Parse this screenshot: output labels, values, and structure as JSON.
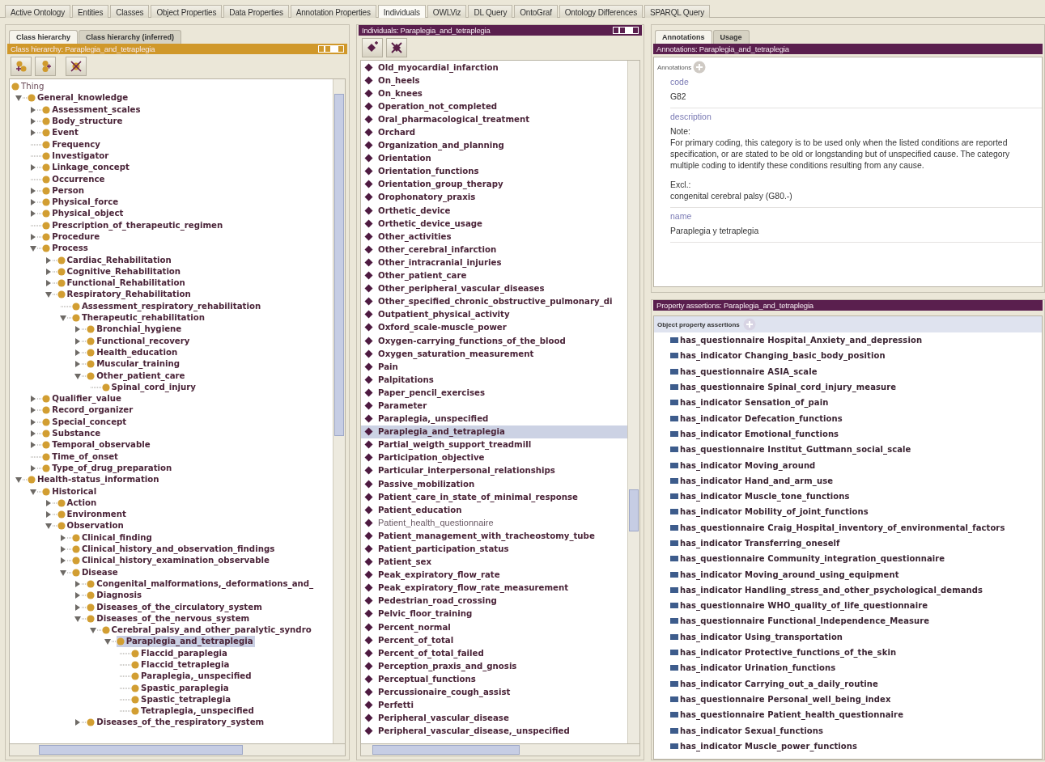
{
  "main_tabs": [
    {
      "label": "Active Ontology",
      "selected": false
    },
    {
      "label": "Entities",
      "selected": false
    },
    {
      "label": "Classes",
      "selected": false
    },
    {
      "label": "Object Properties",
      "selected": false
    },
    {
      "label": "Data Properties",
      "selected": false
    },
    {
      "label": "Annotation Properties",
      "selected": false
    },
    {
      "label": "Individuals",
      "selected": true
    },
    {
      "label": "OWLViz",
      "selected": false
    },
    {
      "label": "DL Query",
      "selected": false
    },
    {
      "label": "OntoGraf",
      "selected": false
    },
    {
      "label": "Ontology Differences",
      "selected": false
    },
    {
      "label": "SPARQL Query",
      "selected": false
    }
  ],
  "class_hierarchy": {
    "tabs": [
      {
        "label": "Class hierarchy",
        "selected": true
      },
      {
        "label": "Class hierarchy (inferred)",
        "selected": false
      }
    ],
    "header": "Class hierarchy: Paraplegia_and_tetraplegia",
    "tree": [
      {
        "label": "Thing",
        "kind": "root",
        "selected": false,
        "children": [
          {
            "label": "General_knowledge",
            "kind": "branch",
            "expanded": true,
            "selected": false,
            "children": [
              {
                "label": "Assessment_scales",
                "kind": "branch",
                "expanded": false,
                "selected": false
              },
              {
                "label": "Body_structure",
                "kind": "branch",
                "expanded": false,
                "selected": false
              },
              {
                "label": "Event",
                "kind": "branch",
                "expanded": false,
                "selected": false
              },
              {
                "label": "Frequency",
                "kind": "leaf",
                "selected": false
              },
              {
                "label": "Investigator",
                "kind": "leaf",
                "selected": false
              },
              {
                "label": "Linkage_concept",
                "kind": "branch",
                "expanded": false,
                "selected": false
              },
              {
                "label": "Occurrence",
                "kind": "leaf",
                "selected": false
              },
              {
                "label": "Person",
                "kind": "branch",
                "expanded": false,
                "selected": false
              },
              {
                "label": "Physical_force",
                "kind": "branch",
                "expanded": false,
                "selected": false
              },
              {
                "label": "Physical_object",
                "kind": "branch",
                "expanded": false,
                "selected": false
              },
              {
                "label": "Prescription_of_therapeutic_regimen",
                "kind": "leaf",
                "selected": false
              },
              {
                "label": "Procedure",
                "kind": "branch",
                "expanded": false,
                "selected": false
              },
              {
                "label": "Process",
                "kind": "branch",
                "expanded": true,
                "selected": false,
                "children": [
                  {
                    "label": "Cardiac_Rehabilitation",
                    "kind": "branch",
                    "expanded": false,
                    "selected": false
                  },
                  {
                    "label": "Cognitive_Rehabilitation",
                    "kind": "branch",
                    "expanded": false,
                    "selected": false
                  },
                  {
                    "label": "Functional_Rehabilitation",
                    "kind": "branch",
                    "expanded": false,
                    "selected": false
                  },
                  {
                    "label": "Respiratory_Rehabilitation",
                    "kind": "branch",
                    "expanded": true,
                    "selected": false,
                    "children": [
                      {
                        "label": "Assessment_respiratory_rehabilitation",
                        "kind": "leaf",
                        "selected": false
                      },
                      {
                        "label": "Therapeutic_rehabilitation",
                        "kind": "branch",
                        "expanded": true,
                        "selected": false,
                        "children": [
                          {
                            "label": "Bronchial_hygiene",
                            "kind": "branch",
                            "expanded": false,
                            "selected": false
                          },
                          {
                            "label": "Functional_recovery",
                            "kind": "branch",
                            "expanded": false,
                            "selected": false
                          },
                          {
                            "label": "Health_education",
                            "kind": "branch",
                            "expanded": false,
                            "selected": false
                          },
                          {
                            "label": "Muscular_training",
                            "kind": "branch",
                            "expanded": false,
                            "selected": false
                          },
                          {
                            "label": "Other_patient_care",
                            "kind": "branch",
                            "expanded": true,
                            "selected": false,
                            "children": [
                              {
                                "label": "Spinal_cord_injury",
                                "kind": "leaf",
                                "selected": false
                              }
                            ]
                          }
                        ]
                      }
                    ]
                  }
                ]
              },
              {
                "label": "Qualifier_value",
                "kind": "branch",
                "expanded": false,
                "selected": false
              },
              {
                "label": "Record_organizer",
                "kind": "branch",
                "expanded": false,
                "selected": false
              },
              {
                "label": "Special_concept",
                "kind": "branch",
                "expanded": false,
                "selected": false
              },
              {
                "label": "Substance",
                "kind": "branch",
                "expanded": false,
                "selected": false
              },
              {
                "label": "Temporal_observable",
                "kind": "branch",
                "expanded": false,
                "selected": false
              },
              {
                "label": "Time_of_onset",
                "kind": "leaf",
                "selected": false
              },
              {
                "label": "Type_of_drug_preparation",
                "kind": "branch",
                "expanded": false,
                "selected": false
              }
            ]
          },
          {
            "label": "Health-status_information",
            "kind": "branch",
            "expanded": true,
            "selected": false,
            "children": [
              {
                "label": "Historical",
                "kind": "branch",
                "expanded": true,
                "selected": false,
                "children": [
                  {
                    "label": "Action",
                    "kind": "branch",
                    "expanded": false,
                    "selected": false
                  },
                  {
                    "label": "Environment",
                    "kind": "branch",
                    "expanded": false,
                    "selected": false
                  },
                  {
                    "label": "Observation",
                    "kind": "branch",
                    "expanded": true,
                    "selected": false,
                    "children": [
                      {
                        "label": "Clinical_finding",
                        "kind": "branch",
                        "expanded": false,
                        "selected": false
                      },
                      {
                        "label": "Clinical_history_and_observation_findings",
                        "kind": "branch",
                        "expanded": false,
                        "selected": false
                      },
                      {
                        "label": "Clinical_history_examination_observable",
                        "kind": "branch",
                        "expanded": false,
                        "selected": false
                      },
                      {
                        "label": "Disease",
                        "kind": "branch",
                        "expanded": true,
                        "selected": false,
                        "children": [
                          {
                            "label": "Congenital_malformations,_deformations_and_",
                            "kind": "branch",
                            "expanded": false,
                            "selected": false
                          },
                          {
                            "label": "Diagnosis",
                            "kind": "branch",
                            "expanded": false,
                            "selected": false
                          },
                          {
                            "label": "Diseases_of_the_circulatory_system",
                            "kind": "branch",
                            "expanded": false,
                            "selected": false
                          },
                          {
                            "label": "Diseases_of_the_nervous_system",
                            "kind": "branch",
                            "expanded": true,
                            "selected": false,
                            "children": [
                              {
                                "label": "Cerebral_palsy_and_other_paralytic_syndro",
                                "kind": "branch",
                                "expanded": true,
                                "selected": false,
                                "children": [
                                  {
                                    "label": "Paraplegia_and_tetraplegia",
                                    "kind": "branch",
                                    "expanded": true,
                                    "selected": true,
                                    "children": [
                                      {
                                        "label": "Flaccid_paraplegia",
                                        "kind": "leaf",
                                        "selected": false
                                      },
                                      {
                                        "label": "Flaccid_tetraplegia",
                                        "kind": "leaf",
                                        "selected": false
                                      },
                                      {
                                        "label": "Paraplegia,_unspecified",
                                        "kind": "leaf",
                                        "selected": false
                                      },
                                      {
                                        "label": "Spastic_paraplegia",
                                        "kind": "leaf",
                                        "selected": false
                                      },
                                      {
                                        "label": "Spastic_tetraplegia",
                                        "kind": "leaf",
                                        "selected": false
                                      },
                                      {
                                        "label": "Tetraplegia,_unspecified",
                                        "kind": "leaf",
                                        "selected": false
                                      }
                                    ]
                                  }
                                ]
                              }
                            ]
                          },
                          {
                            "label": "Diseases_of_the_respiratory_system",
                            "kind": "branch",
                            "expanded": false,
                            "selected": false
                          }
                        ]
                      }
                    ]
                  }
                ]
              }
            ]
          }
        ]
      }
    ]
  },
  "individuals": {
    "header": "Individuals: Paraplegia_and_tetraplegia",
    "items": [
      {
        "label": "Old_myocardial_infarction",
        "bold": true,
        "selected": false
      },
      {
        "label": "On_heels",
        "bold": true,
        "selected": false
      },
      {
        "label": "On_knees",
        "bold": true,
        "selected": false
      },
      {
        "label": "Operation_not_completed",
        "bold": true,
        "selected": false
      },
      {
        "label": "Oral_pharmacological_treatment",
        "bold": true,
        "selected": false
      },
      {
        "label": "Orchard",
        "bold": true,
        "selected": false
      },
      {
        "label": "Organization_and_planning",
        "bold": true,
        "selected": false
      },
      {
        "label": "Orientation",
        "bold": true,
        "selected": false
      },
      {
        "label": "Orientation_functions",
        "bold": true,
        "selected": false
      },
      {
        "label": "Orientation_group_therapy",
        "bold": true,
        "selected": false
      },
      {
        "label": "Orophonatory_praxis",
        "bold": true,
        "selected": false
      },
      {
        "label": "Orthetic_device",
        "bold": true,
        "selected": false
      },
      {
        "label": "Orthetic_device_usage",
        "bold": true,
        "selected": false
      },
      {
        "label": "Other_activities",
        "bold": true,
        "selected": false
      },
      {
        "label": "Other_cerebral_infarction",
        "bold": true,
        "selected": false
      },
      {
        "label": "Other_intracranial_injuries",
        "bold": true,
        "selected": false
      },
      {
        "label": "Other_patient_care",
        "bold": true,
        "selected": false
      },
      {
        "label": "Other_peripheral_vascular_diseases",
        "bold": true,
        "selected": false
      },
      {
        "label": "Other_specified_chronic_obstructive_pulmonary_di",
        "bold": true,
        "selected": false
      },
      {
        "label": "Outpatient_physical_activity",
        "bold": true,
        "selected": false
      },
      {
        "label": "Oxford_scale-muscle_power",
        "bold": true,
        "selected": false
      },
      {
        "label": "Oxygen-carrying_functions_of_the_blood",
        "bold": true,
        "selected": false
      },
      {
        "label": "Oxygen_saturation_measurement",
        "bold": true,
        "selected": false
      },
      {
        "label": "Pain",
        "bold": true,
        "selected": false
      },
      {
        "label": "Palpitations",
        "bold": true,
        "selected": false
      },
      {
        "label": "Paper_pencil_exercises",
        "bold": true,
        "selected": false
      },
      {
        "label": "Parameter",
        "bold": true,
        "selected": false
      },
      {
        "label": "Paraplegia,_unspecified",
        "bold": true,
        "selected": false
      },
      {
        "label": "Paraplegia_and_tetraplegia",
        "bold": true,
        "selected": true
      },
      {
        "label": "Partial_weigth_support_treadmill",
        "bold": true,
        "selected": false
      },
      {
        "label": "Participation_objective",
        "bold": true,
        "selected": false
      },
      {
        "label": "Particular_interpersonal_relationships",
        "bold": true,
        "selected": false
      },
      {
        "label": "Passive_mobilization",
        "bold": true,
        "selected": false
      },
      {
        "label": "Patient_care_in_state_of_minimal_response",
        "bold": true,
        "selected": false
      },
      {
        "label": "Patient_education",
        "bold": true,
        "selected": false
      },
      {
        "label": "Patient_health_questionnaire",
        "bold": false,
        "selected": false
      },
      {
        "label": "Patient_management_with_tracheostomy_tube",
        "bold": true,
        "selected": false
      },
      {
        "label": "Patient_participation_status",
        "bold": true,
        "selected": false
      },
      {
        "label": "Patient_sex",
        "bold": true,
        "selected": false
      },
      {
        "label": "Peak_expiratory_flow_rate",
        "bold": true,
        "selected": false
      },
      {
        "label": "Peak_expiratory_flow_rate_measurement",
        "bold": true,
        "selected": false
      },
      {
        "label": "Pedestrian_road_crossing",
        "bold": true,
        "selected": false
      },
      {
        "label": "Pelvic_floor_training",
        "bold": true,
        "selected": false
      },
      {
        "label": "Percent_normal",
        "bold": true,
        "selected": false
      },
      {
        "label": "Percent_of_total",
        "bold": true,
        "selected": false
      },
      {
        "label": "Percent_of_total_failed",
        "bold": true,
        "selected": false
      },
      {
        "label": "Perception_praxis_and_gnosis",
        "bold": true,
        "selected": false
      },
      {
        "label": "Perceptual_functions",
        "bold": true,
        "selected": false
      },
      {
        "label": "Percussionaire_cough_assist",
        "bold": true,
        "selected": false
      },
      {
        "label": "Perfetti",
        "bold": true,
        "selected": false
      },
      {
        "label": "Peripheral_vascular_disease",
        "bold": true,
        "selected": false
      },
      {
        "label": "Peripheral_vascular_disease,_unspecified",
        "bold": true,
        "selected": false
      }
    ]
  },
  "details": {
    "tabs": [
      {
        "label": "Annotations",
        "selected": true
      },
      {
        "label": "Usage",
        "selected": false
      }
    ],
    "header": "Annotations: Paraplegia_and_tetraplegia",
    "annotations_label": "Annotations",
    "annotations": [
      {
        "property": "code",
        "paragraphs": [
          [
            "G82"
          ]
        ]
      },
      {
        "property": "description",
        "paragraphs": [
          [
            "Note:",
            "For primary coding, this category is to be used only when the listed conditions are reported",
            "specification, or are stated to be old or longstanding but of unspecified cause. The category",
            "multiple coding to identify these conditions resulting from any cause."
          ],
          [
            "Excl.:",
            "congenital cerebral palsy (G80.-)"
          ]
        ]
      },
      {
        "property": "name",
        "paragraphs": [
          [
            "Paraplegia y tetraplegia"
          ]
        ]
      }
    ]
  },
  "property_assertions": {
    "header": "Property assertions: Paraplegia_and_tetraplegia",
    "section": "Object property assertions",
    "rows": [
      {
        "property": "has_questionnaire",
        "value": "Hospital_Anxiety_and_depression"
      },
      {
        "property": "has_indicator",
        "value": "Changing_basic_body_position"
      },
      {
        "property": "has_questionnaire",
        "value": "ASIA_scale"
      },
      {
        "property": "has_questionnaire",
        "value": "Spinal_cord_injury_measure"
      },
      {
        "property": "has_indicator",
        "value": "Sensation_of_pain"
      },
      {
        "property": "has_indicator",
        "value": "Defecation_functions"
      },
      {
        "property": "has_indicator",
        "value": "Emotional_functions"
      },
      {
        "property": "has_questionnaire",
        "value": "Institut_Guttmann_social_scale"
      },
      {
        "property": "has_indicator",
        "value": "Moving_around"
      },
      {
        "property": "has_indicator",
        "value": "Hand_and_arm_use"
      },
      {
        "property": "has_indicator",
        "value": "Muscle_tone_functions"
      },
      {
        "property": "has_indicator",
        "value": "Mobility_of_joint_functions"
      },
      {
        "property": "has_questionnaire",
        "value": "Craig_Hospital_inventory_of_environmental_factors"
      },
      {
        "property": "has_indicator",
        "value": "Transferring_oneself"
      },
      {
        "property": "has_questionnaire",
        "value": "Community_integration_questionnaire"
      },
      {
        "property": "has_indicator",
        "value": "Moving_around_using_equipment"
      },
      {
        "property": "has_indicator",
        "value": "Handling_stress_and_other_psychological_demands"
      },
      {
        "property": "has_questionnaire",
        "value": "WHO_quality_of_life_questionnaire"
      },
      {
        "property": "has_questionnaire",
        "value": "Functional_Independence_Measure"
      },
      {
        "property": "has_indicator",
        "value": "Using_transportation"
      },
      {
        "property": "has_indicator",
        "value": "Protective_functions_of_the_skin"
      },
      {
        "property": "has_indicator",
        "value": "Urination_functions"
      },
      {
        "property": "has_indicator",
        "value": "Carrying_out_a_daily_routine"
      },
      {
        "property": "has_questionnaire",
        "value": "Personal_well_being_index"
      },
      {
        "property": "has_questionnaire",
        "value": "Patient_health_questionnaire"
      },
      {
        "property": "has_indicator",
        "value": "Sexual_functions"
      },
      {
        "property": "has_indicator",
        "value": "Muscle_power_functions"
      }
    ]
  }
}
